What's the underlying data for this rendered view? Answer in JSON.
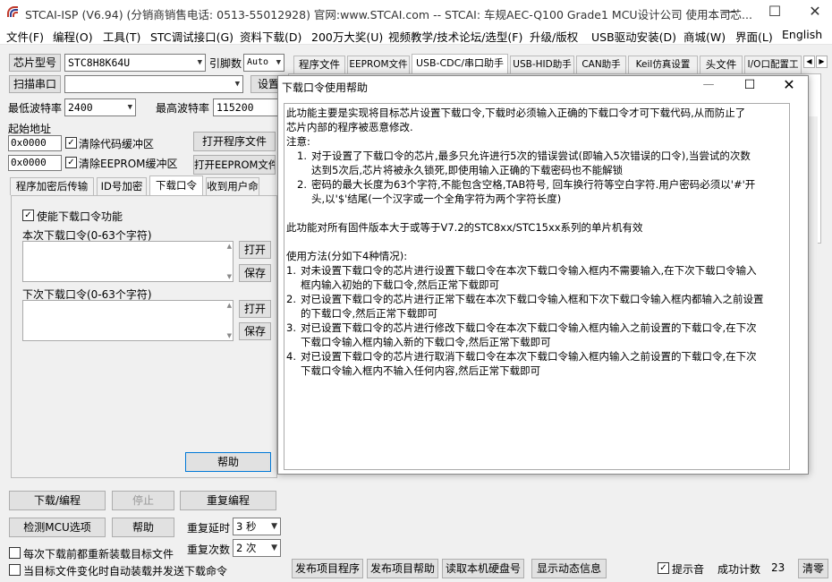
{
  "window": {
    "title": "STCAI-ISP (V6.94) (分销商销售电话: 0513-55012928) 官网:www.STCAI.com  -- STCAI: 车规AEC-Q100 Grade1 MCU设计公司 使用本司芯...",
    "minimize": "—",
    "maximize": "☐",
    "close": "✕"
  },
  "menu": [
    "文件(F)",
    "编程(O)",
    "工具(T)",
    "STC调试接口(G)",
    "资料下载(D)",
    "200万大奖(U)",
    "视频教学/技术论坛/选型(F)",
    "升级/版权",
    "USB驱动安装(D)",
    "商城(W)",
    "界面(L)",
    "English"
  ],
  "left": {
    "chip_label": "芯片型号",
    "chip_value": "STC8H8K64U",
    "pin_label": "引脚数",
    "pin_value": "Auto",
    "scan_label": "扫描串口",
    "port_value": "",
    "settings_label": "设置",
    "min_baud_label": "最低波特率",
    "min_baud": "2400",
    "max_baud_label": "最高波特率",
    "max_baud": "115200",
    "start_addr_label": "起始地址",
    "addr1": "0x0000",
    "clear_code": "清除代码缓冲区",
    "open_prog": "打开程序文件",
    "addr2": "0x0000",
    "clear_eeprom": "清除EEPROM缓冲区",
    "open_eeprom": "打开EEPROM文件",
    "tabs": [
      "程序加密后传输",
      "ID号加密",
      "下载口令",
      "收到用户命"
    ],
    "panel": {
      "enable_label": "使能下载口令功能",
      "current_label": "本次下载口令(0-63个字符)",
      "next_label": "下次下载口令(0-63个字符)",
      "open1": "打开",
      "save1": "保存",
      "open2": "打开",
      "save2": "保存",
      "help": "帮助"
    },
    "download_btn": "下载/编程",
    "stop_btn": "停止",
    "reprog_btn": "重复编程",
    "detect_btn": "检测MCU选项",
    "help_btn": "帮助",
    "repeat_delay_label": "重复延时",
    "repeat_delay": "3 秒",
    "repeat_count_label": "重复次数",
    "repeat_count": "2 次",
    "reload_label": "每次下载前都重新装载目标文件",
    "auto_label": "当目标文件变化时自动装载并发送下载命令"
  },
  "right": {
    "tabs": [
      "程序文件",
      "EEPROM文件",
      "USB-CDC/串口助手",
      "USB-HID助手",
      "CAN助手",
      "Keil仿真设置",
      "头文件",
      "I/O口配置工"
    ],
    "scroll_left": "◀",
    "scroll_right": "▶"
  },
  "dialog": {
    "title": "下载口令使用帮助",
    "lines": [
      "此功能主要是实现将目标芯片设置下载口令,下载时必须输入正确的下载口令才可下载代码,从而防止了",
      "芯片内部的程序被恶意修改.",
      "注意:"
    ],
    "notes": [
      {
        "n": "1.",
        "l1": "对于设置了下载口令的芯片,最多只允许进行5次的错误尝试(即输入5次错误的口令),当尝试的次数",
        "l2": "达到5次后,芯片将被永久锁死,即使用输入正确的下载密码也不能解锁"
      },
      {
        "n": "2.",
        "l1": "密码的最大长度为63个字符,不能包含空格,TAB符号, 回车换行符等空白字符.用户密码必须以'#'开",
        "l2": "头,以'$'结尾(一个汉字或一个全角字符为两个字符长度)"
      }
    ],
    "applies": "此功能对所有固件版本大于或等于V7.2的STC8xx/STC15xx系列的单片机有效",
    "usage_title": "使用方法(分如下4种情况):",
    "usage": [
      {
        "n": "1.",
        "l1": "对未设置下载口令的芯片进行设置下载口令在本次下载口令输入框内不需要输入,在下次下载口令输入",
        "l2": "框内输入初始的下载口令,然后正常下载即可"
      },
      {
        "n": "2.",
        "l1": "对已设置下载口令的芯片进行正常下载在本次下载口令输入框和下次下载口令输入框内都输入之前设置",
        "l2": "的下载口令,然后正常下载即可"
      },
      {
        "n": "3.",
        "l1": "对已设置下载口令的芯片进行修改下载口令在本次下载口令输入框内输入之前设置的下载口令,在下次",
        "l2": "下载口令输入框内输入新的下载口令,然后正常下载即可"
      },
      {
        "n": "4.",
        "l1": "对已设置下载口令的芯片进行取消下载口令在本次下载口令输入框内输入之前设置的下载口令,在下次",
        "l2": "下载口令输入框内不输入任何内容,然后正常下载即可"
      }
    ]
  },
  "bottom": {
    "publish_prog": "发布项目程序",
    "publish_help": "发布项目帮助",
    "read_disk": "读取本机硬盘号",
    "show_info": "显示动态信息",
    "beep_label": "提示音",
    "success_label": "成功计数",
    "success_count": "23",
    "clear_btn": "清零"
  },
  "colors": {
    "accent": "#0078d7",
    "titlebar": "#ffffff",
    "window": "#f0f0f0"
  }
}
